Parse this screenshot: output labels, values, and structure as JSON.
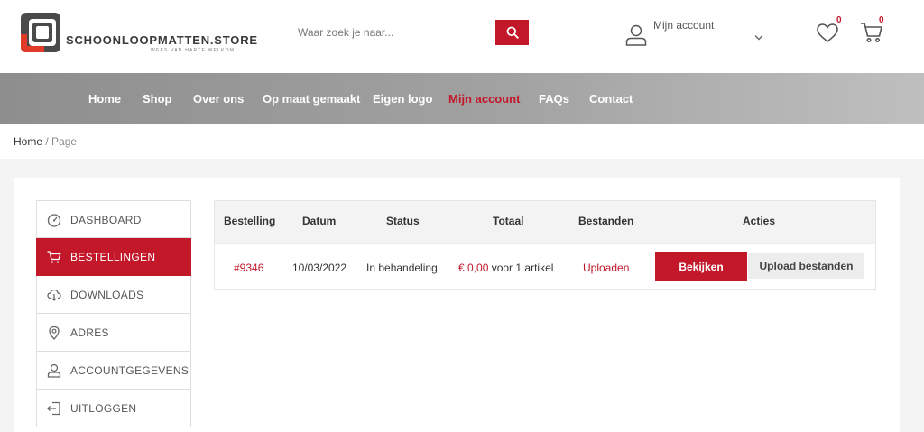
{
  "header": {
    "logo_name": "SCHOONLOOPMATTEN.STORE",
    "logo_tagline": "WEES VAN HARTE WELKOM",
    "search_placeholder": "Waar zoek je naar...",
    "account_label": "Mijn account",
    "wishlist_count": "0",
    "cart_count": "0"
  },
  "nav": {
    "items": [
      {
        "label": "Home"
      },
      {
        "label": "Shop"
      },
      {
        "label": "Over ons"
      },
      {
        "label": "Op maat gemaakt"
      },
      {
        "label": "Eigen logo"
      },
      {
        "label": "Mijn account",
        "active": true
      },
      {
        "label": "FAQs"
      },
      {
        "label": "Contact"
      }
    ]
  },
  "breadcrumb": {
    "home": "Home",
    "separator": " / ",
    "current": "Page"
  },
  "sidebar": {
    "items": [
      {
        "label": "DASHBOARD",
        "icon": "dashboard-icon"
      },
      {
        "label": "BESTELLINGEN",
        "icon": "cart-icon",
        "active": true
      },
      {
        "label": "DOWNLOADS",
        "icon": "cloud-download-icon"
      },
      {
        "label": "ADRES",
        "icon": "location-pin-icon"
      },
      {
        "label": "ACCOUNTGEGEVENS",
        "icon": "user-icon"
      },
      {
        "label": "UITLOGGEN",
        "icon": "logout-icon"
      }
    ]
  },
  "orders": {
    "headers": [
      "Bestelling",
      "Datum",
      "Status",
      "Totaal",
      "Bestanden",
      "Acties"
    ],
    "rows": [
      {
        "order": "#9346",
        "date": "10/03/2022",
        "status": "In behandeling",
        "total_amount": "€ 0,00",
        "total_suffix": " voor 1 artikel",
        "files": "Uploaden",
        "view_label": "Bekijken",
        "upload_label": "Upload bestanden"
      }
    ]
  },
  "colors": {
    "accent": "#c3172a",
    "nav_bg": "#a2a2a2",
    "page_bg": "#f4f4f4"
  }
}
